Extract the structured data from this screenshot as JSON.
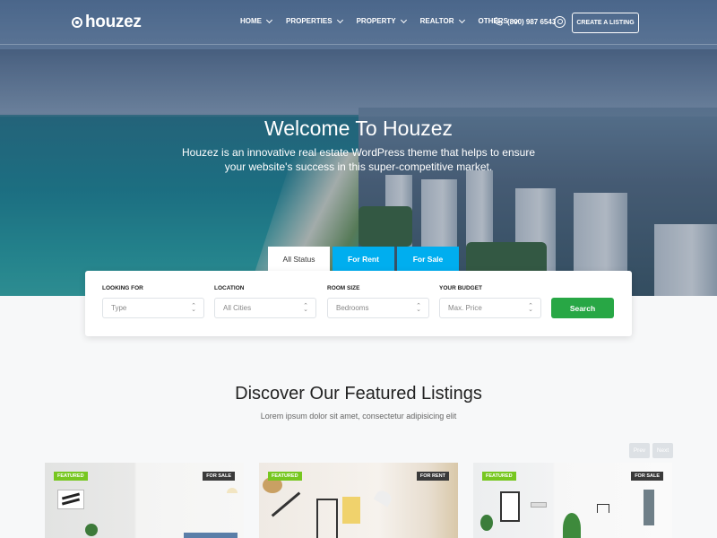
{
  "brand": {
    "name": "houzez"
  },
  "nav": {
    "items": [
      {
        "label": "Home"
      },
      {
        "label": "Properties"
      },
      {
        "label": "Property"
      },
      {
        "label": "Realtor"
      },
      {
        "label": "Others"
      }
    ],
    "phone": "(800) 987 6543",
    "create_label": "Create a Listing"
  },
  "hero": {
    "title": "Welcome To Houzez",
    "subtitle": "Houzez is an innovative real estate WordPress theme that helps to ensure your website's success in this super-competitive market."
  },
  "search": {
    "tabs": [
      {
        "label": "All Status",
        "active": true
      },
      {
        "label": "For Rent",
        "active": false
      },
      {
        "label": "For Sale",
        "active": false
      }
    ],
    "fields": [
      {
        "label": "Looking For",
        "placeholder": "Type"
      },
      {
        "label": "Location",
        "placeholder": "All Cities"
      },
      {
        "label": "Room Size",
        "placeholder": "Bedrooms"
      },
      {
        "label": "Your Budget",
        "placeholder": "Max. Price"
      }
    ],
    "button_label": "Search"
  },
  "featured": {
    "title": "Discover Our Featured Listings",
    "subtitle": "Lorem ipsum dolor sit amet, consectetur adipisicing elit",
    "prev_label": "Prev",
    "next_label": "Next",
    "cards": [
      {
        "badge": "Featured",
        "status": "For Sale"
      },
      {
        "badge": "Featured",
        "status": "For Rent"
      },
      {
        "badge": "Featured",
        "status": "For Sale"
      }
    ]
  },
  "colors": {
    "accent": "#00aeef",
    "search_button": "#28a745",
    "featured_badge": "#77c720"
  }
}
